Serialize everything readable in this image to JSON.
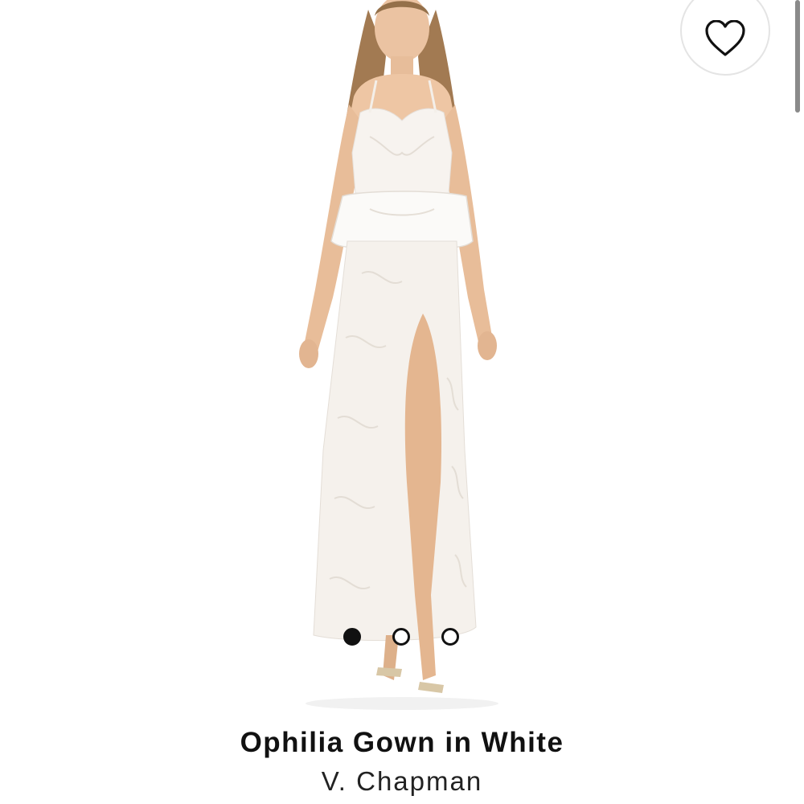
{
  "product": {
    "title": "Ophilia Gown in White",
    "brand": "V. Chapman",
    "image_alt": "Model wearing white lace gown"
  },
  "actions": {
    "favorite_icon": "heart-outline-icon"
  },
  "carousel": {
    "total": 3,
    "active_index": 0
  },
  "colors": {
    "text": "#111111",
    "dot_active": "#111111",
    "border": "#e4e4e4"
  }
}
